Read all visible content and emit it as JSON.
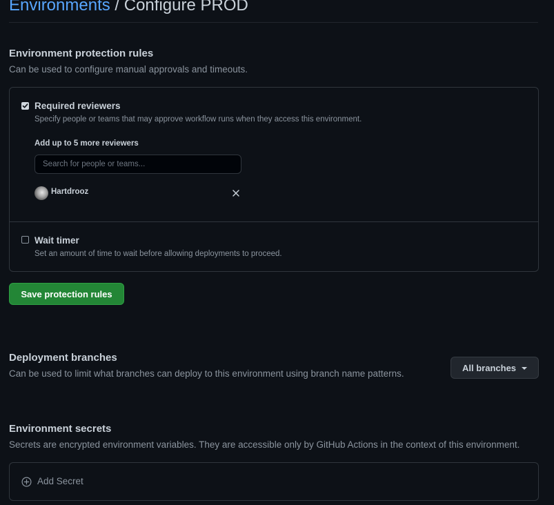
{
  "header": {
    "breadcrumb_link": "Environments",
    "separator": "/",
    "current": "Configure PROD"
  },
  "protection_rules": {
    "title": "Environment protection rules",
    "description": "Can be used to configure manual approvals and timeouts.",
    "required_reviewers": {
      "checked": true,
      "label": "Required reviewers",
      "description": "Specify people or teams that may approve workflow runs when they access this environment.",
      "add_label": "Add up to 5 more reviewers",
      "search_placeholder": "Search for people or teams...",
      "reviewers": [
        {
          "name": "Hartdrooz"
        }
      ]
    },
    "wait_timer": {
      "checked": false,
      "label": "Wait timer",
      "description": "Set an amount of time to wait before allowing deployments to proceed."
    },
    "save_label": "Save protection rules"
  },
  "deployment_branches": {
    "title": "Deployment branches",
    "description": "Can be used to limit what branches can deploy to this environment using branch name patterns.",
    "selected": "All branches"
  },
  "secrets": {
    "title": "Environment secrets",
    "description": "Secrets are encrypted environment variables. They are accessible only by GitHub Actions in the context of this environment.",
    "add_label": "Add Secret"
  },
  "colors": {
    "background": "#0d1117",
    "link": "#58a6ff",
    "primary_button": "#238636",
    "border": "#30363d",
    "muted_text": "#8b949e"
  },
  "icons": {
    "checkbox_checked": "check-icon",
    "remove_reviewer": "close-icon",
    "dropdown": "caret-down-icon",
    "add_secret": "plus-circle-icon"
  }
}
